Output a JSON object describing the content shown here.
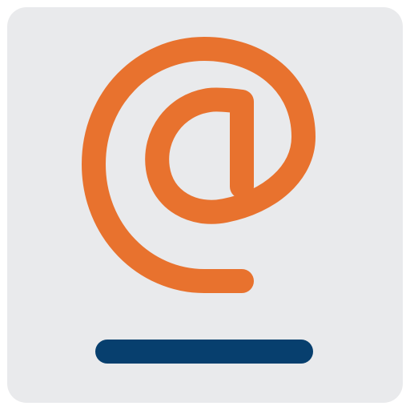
{
  "app_icon": {
    "symbol": "at-sign-icon",
    "colors": {
      "background": "#e9eaec",
      "symbol": "#e8722e",
      "underline": "#073f6e"
    }
  }
}
